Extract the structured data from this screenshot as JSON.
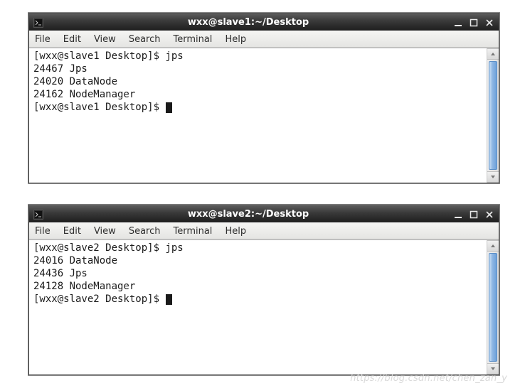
{
  "menu": {
    "file": "File",
    "edit": "Edit",
    "view": "View",
    "search": "Search",
    "terminal": "Terminal",
    "help": "Help"
  },
  "windows": [
    {
      "title": "wxx@slave1:~/Desktop",
      "lines": [
        {
          "prompt": "[wxx@slave1 Desktop]$ ",
          "cmd": "jps"
        },
        {
          "text": "24467 Jps"
        },
        {
          "text": "24020 DataNode"
        },
        {
          "text": "24162 NodeManager"
        },
        {
          "prompt": "[wxx@slave1 Desktop]$ ",
          "cursor": true
        }
      ]
    },
    {
      "title": "wxx@slave2:~/Desktop",
      "lines": [
        {
          "prompt": "[wxx@slave2 Desktop]$ ",
          "cmd": "jps"
        },
        {
          "text": "24016 DataNode"
        },
        {
          "text": "24436 Jps"
        },
        {
          "text": "24128 NodeManager"
        },
        {
          "prompt": "[wxx@slave2 Desktop]$ ",
          "cursor": true
        }
      ]
    }
  ],
  "watermark": "https://blog.csdn.net/chen_zan_y"
}
